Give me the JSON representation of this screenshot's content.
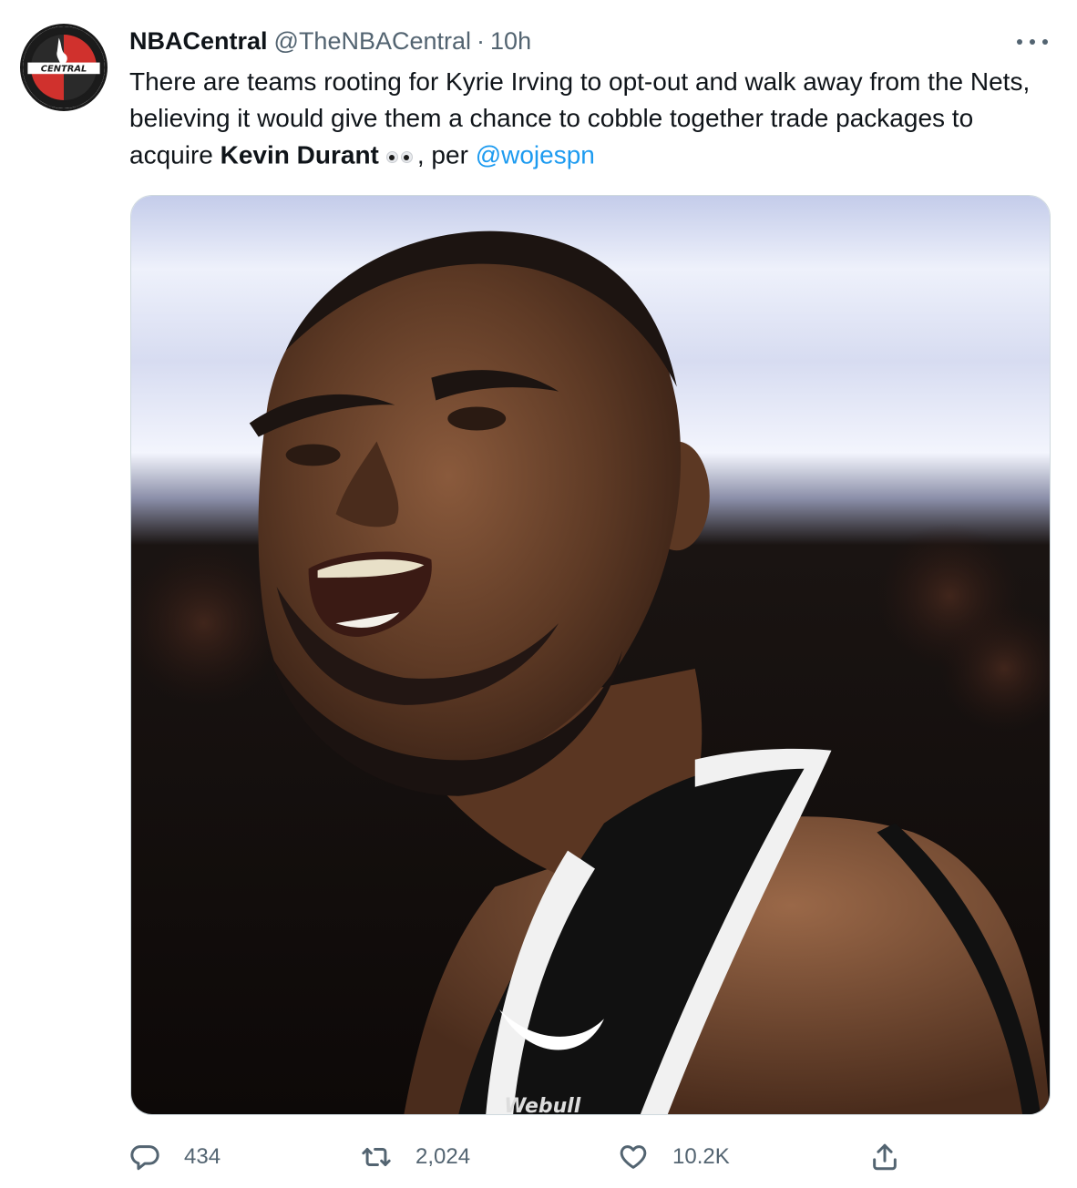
{
  "tweet": {
    "display_name": "NBACentral",
    "handle": "@TheNBACentral",
    "separator": "·",
    "time": "10h",
    "text_before": "There are teams rooting for Kyrie Irving to opt-out and walk away from the Nets, believing it would give them a chance to cobble together trade packages to acquire ",
    "text_bold": "Kevin Durant",
    "text_after": ", per ",
    "mention": "@wojespn",
    "emoji_icon": "eyes-emoji",
    "avatar_text": "CENTRAL",
    "jersey_text": "Webull"
  },
  "actions": {
    "reply_count": "434",
    "retweet_count": "2,024",
    "like_count": "10.2K"
  },
  "colors": {
    "link": "#1d9bf0",
    "secondary_text": "#536471",
    "primary_text": "#0f1419",
    "brand_red": "#d0312d"
  }
}
